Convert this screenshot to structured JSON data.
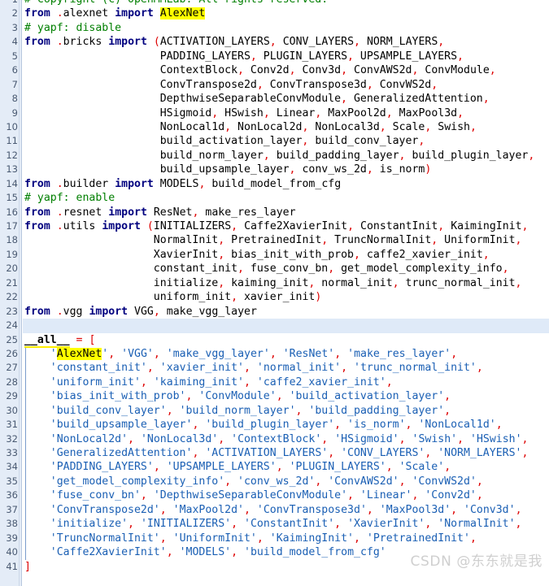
{
  "editor": {
    "language": "python",
    "filename": "__init__.py",
    "first_visible_line": 1,
    "last_visible_line": 41,
    "current_line": 24,
    "search_term": "AlexNet",
    "colors": {
      "background": "#ffffff",
      "gutter_background": "#e4ecf7",
      "gutter_text": "#4a5a72",
      "keyword": "#00007f",
      "comment": "#007f00",
      "string": "#1a5fb4",
      "punctuation": "#dd0000",
      "text": "#000000",
      "current_line_highlight": "#dfeaf8",
      "occurrence_highlight": "#ffff00",
      "indent_guide": "#7a9ccb",
      "watermark": "#cfcfcf"
    }
  },
  "watermark": {
    "text": "CSDN @东东就是我"
  },
  "lines": [
    {
      "n": "1",
      "text": "# Copyright (c) OpenMMLab. All rights reserved."
    },
    {
      "n": "2",
      "text": "from .alexnet import AlexNet"
    },
    {
      "n": "3",
      "text": "# yapf: disable"
    },
    {
      "n": "4",
      "text": "from .bricks import (ACTIVATION_LAYERS, CONV_LAYERS, NORM_LAYERS,"
    },
    {
      "n": "5",
      "text": "                     PADDING_LAYERS, PLUGIN_LAYERS, UPSAMPLE_LAYERS,"
    },
    {
      "n": "6",
      "text": "                     ContextBlock, Conv2d, Conv3d, ConvAWS2d, ConvModule,"
    },
    {
      "n": "7",
      "text": "                     ConvTranspose2d, ConvTranspose3d, ConvWS2d,"
    },
    {
      "n": "8",
      "text": "                     DepthwiseSeparableConvModule, GeneralizedAttention,"
    },
    {
      "n": "9",
      "text": "                     HSigmoid, HSwish, Linear, MaxPool2d, MaxPool3d,"
    },
    {
      "n": "10",
      "text": "                     NonLocal1d, NonLocal2d, NonLocal3d, Scale, Swish,"
    },
    {
      "n": "11",
      "text": "                     build_activation_layer, build_conv_layer,"
    },
    {
      "n": "12",
      "text": "                     build_norm_layer, build_padding_layer, build_plugin_layer,"
    },
    {
      "n": "13",
      "text": "                     build_upsample_layer, conv_ws_2d, is_norm)"
    },
    {
      "n": "14",
      "text": "from .builder import MODELS, build_model_from_cfg"
    },
    {
      "n": "15",
      "text": "# yapf: enable"
    },
    {
      "n": "16",
      "text": "from .resnet import ResNet, make_res_layer"
    },
    {
      "n": "17",
      "text": "from .utils import (INITIALIZERS, Caffe2XavierInit, ConstantInit, KaimingInit,"
    },
    {
      "n": "18",
      "text": "                    NormalInit, PretrainedInit, TruncNormalInit, UniformInit,"
    },
    {
      "n": "19",
      "text": "                    XavierInit, bias_init_with_prob, caffe2_xavier_init,"
    },
    {
      "n": "20",
      "text": "                    constant_init, fuse_conv_bn, get_model_complexity_info,"
    },
    {
      "n": "21",
      "text": "                    initialize, kaiming_init, normal_init, trunc_normal_init,"
    },
    {
      "n": "22",
      "text": "                    uniform_init, xavier_init)"
    },
    {
      "n": "23",
      "text": "from .vgg import VGG, make_vgg_layer"
    },
    {
      "n": "24",
      "text": ""
    },
    {
      "n": "25",
      "text": "__all__ = ["
    },
    {
      "n": "26",
      "text": "    'AlexNet', 'VGG', 'make_vgg_layer', 'ResNet', 'make_res_layer',"
    },
    {
      "n": "27",
      "text": "    'constant_init', 'xavier_init', 'normal_init', 'trunc_normal_init',"
    },
    {
      "n": "28",
      "text": "    'uniform_init', 'kaiming_init', 'caffe2_xavier_init',"
    },
    {
      "n": "29",
      "text": "    'bias_init_with_prob', 'ConvModule', 'build_activation_layer',"
    },
    {
      "n": "30",
      "text": "    'build_conv_layer', 'build_norm_layer', 'build_padding_layer',"
    },
    {
      "n": "31",
      "text": "    'build_upsample_layer', 'build_plugin_layer', 'is_norm', 'NonLocal1d',"
    },
    {
      "n": "32",
      "text": "    'NonLocal2d', 'NonLocal3d', 'ContextBlock', 'HSigmoid', 'Swish', 'HSwish',"
    },
    {
      "n": "33",
      "text": "    'GeneralizedAttention', 'ACTIVATION_LAYERS', 'CONV_LAYERS', 'NORM_LAYERS',"
    },
    {
      "n": "34",
      "text": "    'PADDING_LAYERS', 'UPSAMPLE_LAYERS', 'PLUGIN_LAYERS', 'Scale',"
    },
    {
      "n": "35",
      "text": "    'get_model_complexity_info', 'conv_ws_2d', 'ConvAWS2d', 'ConvWS2d',"
    },
    {
      "n": "36",
      "text": "    'fuse_conv_bn', 'DepthwiseSeparableConvModule', 'Linear', 'Conv2d',"
    },
    {
      "n": "37",
      "text": "    'ConvTranspose2d', 'MaxPool2d', 'ConvTranspose3d', 'MaxPool3d', 'Conv3d',"
    },
    {
      "n": "38",
      "text": "    'initialize', 'INITIALIZERS', 'ConstantInit', 'XavierInit', 'NormalInit',"
    },
    {
      "n": "39",
      "text": "    'TruncNormalInit', 'UniformInit', 'KaimingInit', 'PretrainedInit',"
    },
    {
      "n": "40",
      "text": "    'Caffe2XavierInit', 'MODELS', 'build_model_from_cfg'"
    },
    {
      "n": "41",
      "text": "]"
    }
  ]
}
